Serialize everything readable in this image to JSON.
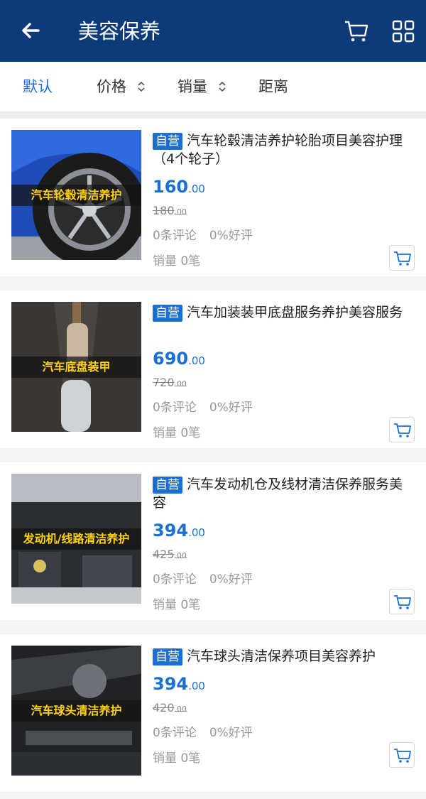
{
  "header": {
    "title": "美容保养",
    "back_icon": "arrow-left-icon",
    "cart_icon": "cart-icon",
    "grid_icon": "grid-icon"
  },
  "sort": {
    "default": "默认",
    "price": "价格",
    "sales": "销量",
    "distance": "距离"
  },
  "colors": {
    "header_bg": "#0d3a78",
    "accent": "#1a6fd4",
    "caption_text": "#ffd200"
  },
  "products": [
    {
      "badge": "自营",
      "title": "汽车轮毂清洁养护轮胎项目美容护理（4个轮子）",
      "caption": "汽车轮毂清洁养护",
      "price_int": "160",
      "price_dec": ".00",
      "old_int": "180",
      "old_dec": ".00",
      "reviews": "0条评论",
      "positive": "0%好评",
      "sales": "销量 0笔"
    },
    {
      "badge": "自营",
      "title": "汽车加装装甲底盘服务养护美容服务",
      "caption": "汽车底盘装甲",
      "price_int": "690",
      "price_dec": ".00",
      "old_int": "720",
      "old_dec": ".00",
      "reviews": "0条评论",
      "positive": "0%好评",
      "sales": "销量 0笔"
    },
    {
      "badge": "自营",
      "title": "汽车发动机仓及线材清洁保养服务美容",
      "caption": "发动机/线路清洁养护",
      "price_int": "394",
      "price_dec": ".00",
      "old_int": "425",
      "old_dec": ".00",
      "reviews": "0条评论",
      "positive": "0%好评",
      "sales": "销量 0笔"
    },
    {
      "badge": "自营",
      "title": "汽车球头清洁保养项目美容养护",
      "caption": "汽车球头清洁养护",
      "price_int": "394",
      "price_dec": ".00",
      "old_int": "420",
      "old_dec": ".00",
      "reviews": "0条评论",
      "positive": "0%好评",
      "sales": "销量 0笔"
    }
  ]
}
